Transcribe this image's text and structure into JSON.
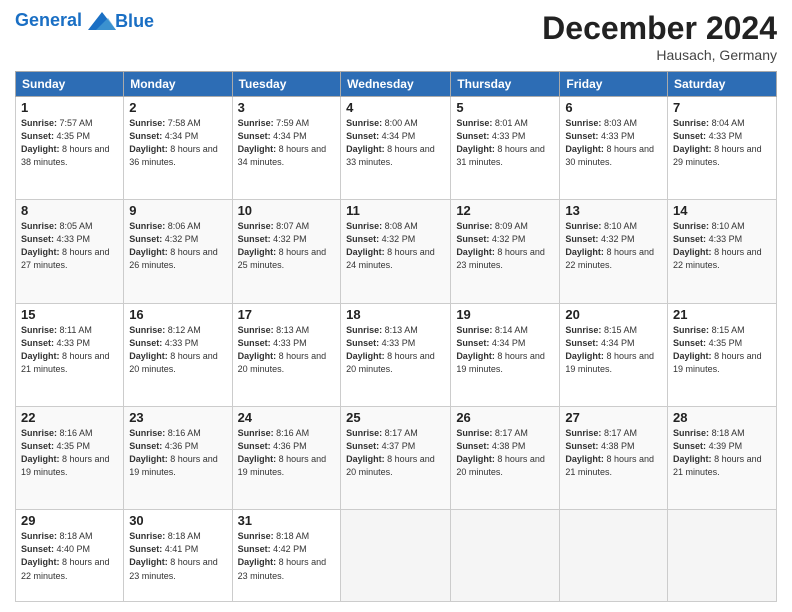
{
  "header": {
    "logo_line1": "General",
    "logo_line2": "Blue",
    "month": "December 2024",
    "location": "Hausach, Germany"
  },
  "days_of_week": [
    "Sunday",
    "Monday",
    "Tuesday",
    "Wednesday",
    "Thursday",
    "Friday",
    "Saturday"
  ],
  "weeks": [
    [
      {
        "day": "1",
        "info": "Sunrise: 7:57 AM\nSunset: 4:35 PM\nDaylight: 8 hours and 38 minutes."
      },
      {
        "day": "2",
        "info": "Sunrise: 7:58 AM\nSunset: 4:34 PM\nDaylight: 8 hours and 36 minutes."
      },
      {
        "day": "3",
        "info": "Sunrise: 7:59 AM\nSunset: 4:34 PM\nDaylight: 8 hours and 34 minutes."
      },
      {
        "day": "4",
        "info": "Sunrise: 8:00 AM\nSunset: 4:34 PM\nDaylight: 8 hours and 33 minutes."
      },
      {
        "day": "5",
        "info": "Sunrise: 8:01 AM\nSunset: 4:33 PM\nDaylight: 8 hours and 31 minutes."
      },
      {
        "day": "6",
        "info": "Sunrise: 8:03 AM\nSunset: 4:33 PM\nDaylight: 8 hours and 30 minutes."
      },
      {
        "day": "7",
        "info": "Sunrise: 8:04 AM\nSunset: 4:33 PM\nDaylight: 8 hours and 29 minutes."
      }
    ],
    [
      {
        "day": "8",
        "info": "Sunrise: 8:05 AM\nSunset: 4:33 PM\nDaylight: 8 hours and 27 minutes."
      },
      {
        "day": "9",
        "info": "Sunrise: 8:06 AM\nSunset: 4:32 PM\nDaylight: 8 hours and 26 minutes."
      },
      {
        "day": "10",
        "info": "Sunrise: 8:07 AM\nSunset: 4:32 PM\nDaylight: 8 hours and 25 minutes."
      },
      {
        "day": "11",
        "info": "Sunrise: 8:08 AM\nSunset: 4:32 PM\nDaylight: 8 hours and 24 minutes."
      },
      {
        "day": "12",
        "info": "Sunrise: 8:09 AM\nSunset: 4:32 PM\nDaylight: 8 hours and 23 minutes."
      },
      {
        "day": "13",
        "info": "Sunrise: 8:10 AM\nSunset: 4:32 PM\nDaylight: 8 hours and 22 minutes."
      },
      {
        "day": "14",
        "info": "Sunrise: 8:10 AM\nSunset: 4:33 PM\nDaylight: 8 hours and 22 minutes."
      }
    ],
    [
      {
        "day": "15",
        "info": "Sunrise: 8:11 AM\nSunset: 4:33 PM\nDaylight: 8 hours and 21 minutes."
      },
      {
        "day": "16",
        "info": "Sunrise: 8:12 AM\nSunset: 4:33 PM\nDaylight: 8 hours and 20 minutes."
      },
      {
        "day": "17",
        "info": "Sunrise: 8:13 AM\nSunset: 4:33 PM\nDaylight: 8 hours and 20 minutes."
      },
      {
        "day": "18",
        "info": "Sunrise: 8:13 AM\nSunset: 4:33 PM\nDaylight: 8 hours and 20 minutes."
      },
      {
        "day": "19",
        "info": "Sunrise: 8:14 AM\nSunset: 4:34 PM\nDaylight: 8 hours and 19 minutes."
      },
      {
        "day": "20",
        "info": "Sunrise: 8:15 AM\nSunset: 4:34 PM\nDaylight: 8 hours and 19 minutes."
      },
      {
        "day": "21",
        "info": "Sunrise: 8:15 AM\nSunset: 4:35 PM\nDaylight: 8 hours and 19 minutes."
      }
    ],
    [
      {
        "day": "22",
        "info": "Sunrise: 8:16 AM\nSunset: 4:35 PM\nDaylight: 8 hours and 19 minutes."
      },
      {
        "day": "23",
        "info": "Sunrise: 8:16 AM\nSunset: 4:36 PM\nDaylight: 8 hours and 19 minutes."
      },
      {
        "day": "24",
        "info": "Sunrise: 8:16 AM\nSunset: 4:36 PM\nDaylight: 8 hours and 19 minutes."
      },
      {
        "day": "25",
        "info": "Sunrise: 8:17 AM\nSunset: 4:37 PM\nDaylight: 8 hours and 20 minutes."
      },
      {
        "day": "26",
        "info": "Sunrise: 8:17 AM\nSunset: 4:38 PM\nDaylight: 8 hours and 20 minutes."
      },
      {
        "day": "27",
        "info": "Sunrise: 8:17 AM\nSunset: 4:38 PM\nDaylight: 8 hours and 21 minutes."
      },
      {
        "day": "28",
        "info": "Sunrise: 8:18 AM\nSunset: 4:39 PM\nDaylight: 8 hours and 21 minutes."
      }
    ],
    [
      {
        "day": "29",
        "info": "Sunrise: 8:18 AM\nSunset: 4:40 PM\nDaylight: 8 hours and 22 minutes."
      },
      {
        "day": "30",
        "info": "Sunrise: 8:18 AM\nSunset: 4:41 PM\nDaylight: 8 hours and 23 minutes."
      },
      {
        "day": "31",
        "info": "Sunrise: 8:18 AM\nSunset: 4:42 PM\nDaylight: 8 hours and 23 minutes."
      },
      {
        "day": "",
        "info": ""
      },
      {
        "day": "",
        "info": ""
      },
      {
        "day": "",
        "info": ""
      },
      {
        "day": "",
        "info": ""
      }
    ]
  ]
}
